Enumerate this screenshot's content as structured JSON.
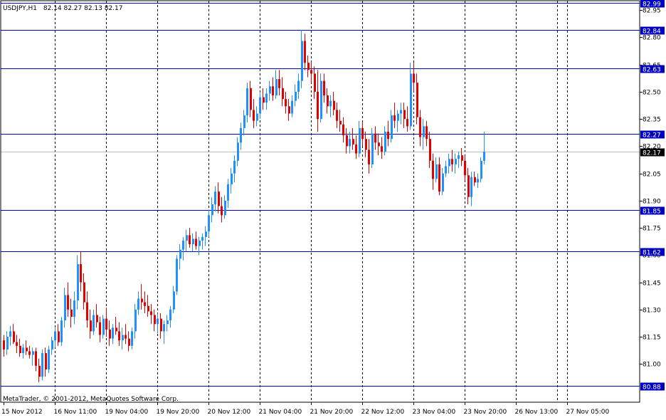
{
  "header": {
    "symbol": "USDJPY,H1",
    "ohlc": "82.14 82.27 82.13 82.17"
  },
  "footer": {
    "copyright": "MetaTrader, © 2001-2012, MetaQuotes Software Corp."
  },
  "colors": {
    "background": "#ffffff",
    "grid": "#000000",
    "bull": "#1e90ff",
    "bear": "#e00000",
    "hline": "#0000c0",
    "hline_label_bg": "#0000c0",
    "hline_label_text": "#ffffff",
    "current_line": "#c0c0c0",
    "current_label_bg": "#000000",
    "current_label_text": "#ffffff"
  },
  "chart_data": {
    "type": "candlestick",
    "ylim": [
      80.86,
      82.99
    ],
    "y_ticks": [
      "82.95",
      "82.80",
      "82.65",
      "82.50",
      "82.35",
      "82.20",
      "82.05",
      "81.90",
      "81.75",
      "81.60",
      "81.45",
      "81.30",
      "81.15",
      "81.00"
    ],
    "x_labels": [
      "15 Nov 2012",
      "16 Nov 11:00",
      "19 Nov 04:00",
      "19 Nov 20:00",
      "20 Nov 12:00",
      "21 Nov 04:00",
      "21 Nov 20:00",
      "22 Nov 12:00",
      "23 Nov 04:00",
      "23 Nov 20:00",
      "26 Nov 13:00",
      "27 Nov 05:00"
    ],
    "x_label_bars": [
      0,
      16,
      32,
      48,
      64,
      80,
      96,
      112,
      128,
      144,
      160,
      176
    ],
    "horizontal_lines": [
      {
        "value": 82.99,
        "label": "82.99"
      },
      {
        "value": 82.84,
        "label": "82.84"
      },
      {
        "value": 82.63,
        "label": "82.63"
      },
      {
        "value": 82.27,
        "label": "82.27"
      },
      {
        "value": 81.85,
        "label": "81.85"
      },
      {
        "value": 81.62,
        "label": "81.62"
      },
      {
        "value": 80.88,
        "label": "80.88"
      }
    ],
    "current_price": {
      "value": 82.17,
      "label": "82.17"
    },
    "candles": [
      [
        81.13,
        81.16,
        81.04,
        81.08
      ],
      [
        81.08,
        81.18,
        81.05,
        81.15
      ],
      [
        81.15,
        81.21,
        81.1,
        81.18
      ],
      [
        81.18,
        81.22,
        81.11,
        81.12
      ],
      [
        81.12,
        81.16,
        81.06,
        81.1
      ],
      [
        81.1,
        81.14,
        81.04,
        81.06
      ],
      [
        81.06,
        81.11,
        81.03,
        81.09
      ],
      [
        81.09,
        81.13,
        81.05,
        81.07
      ],
      [
        81.07,
        81.1,
        81.03,
        81.05
      ],
      [
        81.05,
        81.09,
        80.99,
        81.07
      ],
      [
        81.07,
        81.09,
        80.96,
        80.99
      ],
      [
        80.99,
        81.03,
        80.9,
        80.93
      ],
      [
        80.93,
        81.08,
        80.91,
        81.06
      ],
      [
        81.06,
        81.09,
        80.93,
        80.97
      ],
      [
        80.97,
        81.1,
        80.95,
        81.08
      ],
      [
        81.08,
        81.15,
        81.05,
        81.13
      ],
      [
        81.13,
        81.2,
        81.09,
        81.18
      ],
      [
        81.18,
        81.22,
        81.1,
        81.12
      ],
      [
        81.12,
        81.26,
        81.1,
        81.24
      ],
      [
        81.24,
        81.42,
        81.2,
        81.38
      ],
      [
        81.38,
        81.45,
        81.26,
        81.3
      ],
      [
        81.3,
        81.36,
        81.2,
        81.26
      ],
      [
        81.26,
        81.4,
        81.22,
        81.35
      ],
      [
        81.35,
        81.6,
        81.3,
        81.55
      ],
      [
        81.55,
        81.62,
        81.4,
        81.45
      ],
      [
        81.45,
        81.5,
        81.3,
        81.34
      ],
      [
        81.34,
        81.4,
        81.2,
        81.24
      ],
      [
        81.24,
        81.3,
        81.14,
        81.18
      ],
      [
        81.18,
        81.3,
        81.16,
        81.27
      ],
      [
        81.27,
        81.33,
        81.2,
        81.23
      ],
      [
        81.23,
        81.26,
        81.12,
        81.16
      ],
      [
        81.16,
        81.27,
        81.14,
        81.25
      ],
      [
        81.25,
        81.31,
        81.15,
        81.19
      ],
      [
        81.19,
        81.24,
        81.1,
        81.14
      ],
      [
        81.14,
        81.22,
        81.11,
        81.2
      ],
      [
        81.2,
        81.26,
        81.16,
        81.18
      ],
      [
        81.18,
        81.23,
        81.1,
        81.13
      ],
      [
        81.13,
        81.2,
        81.08,
        81.16
      ],
      [
        81.16,
        81.22,
        81.11,
        81.14
      ],
      [
        81.14,
        81.18,
        81.07,
        81.1
      ],
      [
        81.1,
        81.2,
        81.08,
        81.18
      ],
      [
        81.18,
        81.33,
        81.14,
        81.3
      ],
      [
        81.3,
        81.4,
        81.27,
        81.36
      ],
      [
        81.36,
        81.44,
        81.3,
        81.34
      ],
      [
        81.34,
        81.4,
        81.28,
        81.32
      ],
      [
        81.32,
        81.38,
        81.26,
        81.29
      ],
      [
        81.29,
        81.33,
        81.22,
        81.27
      ],
      [
        81.27,
        81.3,
        81.18,
        81.22
      ],
      [
        81.22,
        81.28,
        81.17,
        81.25
      ],
      [
        81.25,
        81.28,
        81.14,
        81.18
      ],
      [
        81.18,
        81.24,
        81.11,
        81.22
      ],
      [
        81.22,
        81.27,
        81.18,
        81.24
      ],
      [
        81.24,
        81.32,
        81.2,
        81.3
      ],
      [
        81.3,
        81.43,
        81.28,
        81.4
      ],
      [
        81.4,
        81.6,
        81.38,
        81.58
      ],
      [
        81.58,
        81.66,
        81.52,
        81.63
      ],
      [
        81.63,
        81.7,
        81.57,
        81.68
      ],
      [
        81.68,
        81.74,
        81.62,
        81.71
      ],
      [
        81.71,
        81.75,
        81.64,
        81.66
      ],
      [
        81.66,
        81.72,
        81.62,
        81.69
      ],
      [
        81.69,
        81.73,
        81.63,
        81.65
      ],
      [
        81.65,
        81.7,
        81.6,
        81.68
      ],
      [
        81.68,
        81.72,
        81.63,
        81.7
      ],
      [
        81.7,
        81.76,
        81.65,
        81.73
      ],
      [
        81.73,
        81.85,
        81.7,
        81.82
      ],
      [
        81.82,
        81.92,
        81.78,
        81.88
      ],
      [
        81.88,
        81.98,
        81.84,
        81.95
      ],
      [
        81.95,
        82.0,
        81.83,
        81.87
      ],
      [
        81.87,
        81.92,
        81.78,
        81.82
      ],
      [
        81.82,
        81.93,
        81.8,
        81.9
      ],
      [
        81.9,
        82.02,
        81.86,
        81.99
      ],
      [
        81.99,
        82.08,
        81.94,
        82.05
      ],
      [
        82.05,
        82.15,
        82.0,
        82.12
      ],
      [
        82.12,
        82.25,
        82.09,
        82.22
      ],
      [
        82.22,
        82.33,
        82.18,
        82.3
      ],
      [
        82.3,
        82.4,
        82.26,
        82.37
      ],
      [
        82.37,
        82.55,
        82.33,
        82.52
      ],
      [
        82.52,
        82.56,
        82.36,
        82.4
      ],
      [
        82.4,
        82.46,
        82.3,
        82.34
      ],
      [
        82.34,
        82.42,
        82.31,
        82.38
      ],
      [
        82.38,
        82.5,
        82.35,
        82.47
      ],
      [
        82.47,
        82.52,
        82.4,
        82.44
      ],
      [
        82.44,
        82.52,
        82.4,
        82.49
      ],
      [
        82.49,
        82.56,
        82.45,
        82.53
      ],
      [
        82.53,
        82.58,
        82.45,
        82.48
      ],
      [
        82.48,
        82.62,
        82.46,
        82.57
      ],
      [
        82.57,
        82.62,
        82.48,
        82.52
      ],
      [
        82.52,
        82.58,
        82.42,
        82.46
      ],
      [
        82.46,
        82.5,
        82.38,
        82.42
      ],
      [
        82.42,
        82.46,
        82.34,
        82.38
      ],
      [
        82.38,
        82.48,
        82.36,
        82.45
      ],
      [
        82.45,
        82.54,
        82.42,
        82.5
      ],
      [
        82.5,
        82.6,
        82.46,
        82.56
      ],
      [
        82.56,
        82.84,
        82.52,
        82.78
      ],
      [
        82.78,
        82.82,
        82.62,
        82.66
      ],
      [
        82.66,
        82.7,
        82.58,
        82.62
      ],
      [
        82.62,
        82.67,
        82.55,
        82.6
      ],
      [
        82.6,
        82.64,
        82.46,
        82.5
      ],
      [
        82.5,
        82.62,
        82.28,
        82.35
      ],
      [
        82.35,
        82.6,
        82.33,
        82.56
      ],
      [
        82.56,
        82.6,
        82.44,
        82.48
      ],
      [
        82.48,
        82.52,
        82.38,
        82.42
      ],
      [
        82.42,
        82.48,
        82.36,
        82.45
      ],
      [
        82.45,
        82.5,
        82.37,
        82.4
      ],
      [
        82.4,
        82.44,
        82.3,
        82.34
      ],
      [
        82.34,
        82.4,
        82.28,
        82.32
      ],
      [
        82.32,
        82.36,
        82.22,
        82.26
      ],
      [
        82.26,
        82.3,
        82.16,
        82.2
      ],
      [
        82.2,
        82.28,
        82.16,
        82.24
      ],
      [
        82.24,
        82.3,
        82.18,
        82.21
      ],
      [
        82.21,
        82.26,
        82.13,
        82.16
      ],
      [
        82.16,
        82.34,
        82.14,
        82.3
      ],
      [
        82.3,
        82.33,
        82.2,
        82.24
      ],
      [
        82.24,
        82.28,
        82.14,
        82.18
      ],
      [
        82.18,
        82.24,
        82.05,
        82.1
      ],
      [
        82.1,
        82.3,
        82.08,
        82.27
      ],
      [
        82.27,
        82.31,
        82.18,
        82.22
      ],
      [
        82.22,
        82.27,
        82.15,
        82.2
      ],
      [
        82.2,
        82.25,
        82.13,
        82.17
      ],
      [
        82.17,
        82.31,
        82.15,
        82.28
      ],
      [
        82.28,
        82.34,
        82.2,
        82.24
      ],
      [
        82.24,
        82.4,
        82.22,
        82.37
      ],
      [
        82.37,
        82.44,
        82.3,
        82.34
      ],
      [
        82.34,
        82.4,
        82.28,
        82.38
      ],
      [
        82.38,
        82.44,
        82.32,
        82.4
      ],
      [
        82.4,
        82.44,
        82.3,
        82.35
      ],
      [
        82.35,
        82.42,
        82.28,
        82.31
      ],
      [
        82.31,
        82.66,
        82.29,
        82.6
      ],
      [
        82.6,
        82.66,
        82.5,
        82.55
      ],
      [
        82.55,
        82.6,
        82.32,
        82.36
      ],
      [
        82.36,
        82.4,
        82.2,
        82.25
      ],
      [
        82.25,
        82.35,
        82.18,
        82.31
      ],
      [
        82.31,
        82.34,
        82.2,
        82.24
      ],
      [
        82.24,
        82.28,
        82.08,
        82.12
      ],
      [
        82.12,
        82.16,
        81.96,
        82.02
      ],
      [
        82.02,
        82.14,
        82.0,
        82.1
      ],
      [
        82.1,
        82.14,
        81.93,
        81.95
      ],
      [
        81.95,
        82.08,
        81.93,
        82.05
      ],
      [
        82.05,
        82.12,
        82.03,
        82.09
      ],
      [
        82.09,
        82.16,
        82.05,
        82.13
      ],
      [
        82.13,
        82.18,
        82.06,
        82.1
      ],
      [
        82.1,
        82.16,
        82.05,
        82.13
      ],
      [
        82.13,
        82.17,
        82.08,
        82.15
      ],
      [
        82.15,
        82.19,
        82.09,
        82.12
      ],
      [
        82.12,
        82.15,
        82.01,
        82.04
      ],
      [
        82.04,
        82.08,
        81.88,
        81.92
      ],
      [
        81.92,
        82.06,
        81.87,
        82.03
      ],
      [
        82.03,
        82.06,
        81.98,
        82.0
      ],
      [
        82.0,
        82.05,
        81.97,
        82.02
      ],
      [
        82.02,
        82.14,
        82.0,
        82.12
      ],
      [
        82.12,
        82.28,
        82.1,
        82.17
      ]
    ]
  }
}
